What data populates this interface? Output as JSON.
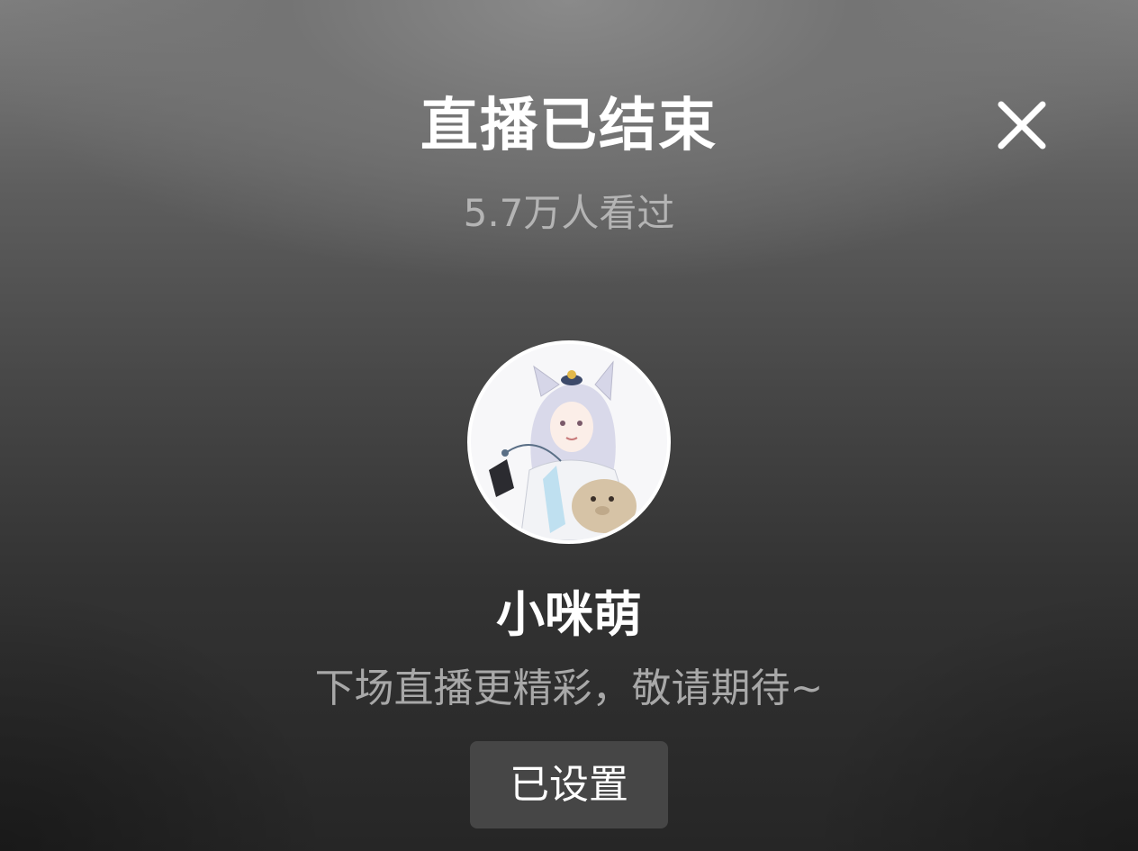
{
  "header": {
    "title": "直播已结束",
    "close_icon": "close-icon"
  },
  "stats": {
    "viewers_text": "5.7万人看过"
  },
  "streamer": {
    "avatar_icon": "avatar-illustration",
    "name": "小咪萌",
    "message": "下场直播更精彩，敬请期待~"
  },
  "actions": {
    "reminder_button_label": "已设置"
  },
  "colors": {
    "title": "#ffffff",
    "secondary_text": "#b4b4b4",
    "button_bg": "#464646"
  }
}
